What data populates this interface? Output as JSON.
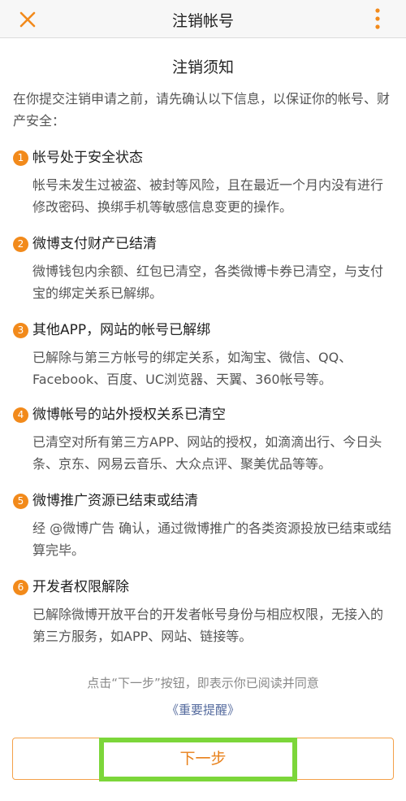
{
  "header": {
    "title": "注销帐号"
  },
  "notice": {
    "title": "注销须知",
    "intro": "在你提交注销申请之前，请先确认以下信息，以保证你的帐号、财产安全："
  },
  "items": [
    {
      "index": "1",
      "title": "帐号处于安全状态",
      "desc": "帐号未发生过被盗、被封等风险，且在最近一个月内没有进行修改密码、换绑手机等敏感信息变更的操作。"
    },
    {
      "index": "2",
      "title": "微博支付财产已结清",
      "desc": "微博钱包内余额、红包已清空，各类微博卡券已清空，与支付宝的绑定关系已解绑。"
    },
    {
      "index": "3",
      "title": "其他APP，网站的帐号已解绑",
      "desc": "已解除与第三方帐号的绑定关系，如淘宝、微信、QQ、Facebook、百度、UC浏览器、天翼、360帐号等。"
    },
    {
      "index": "4",
      "title": "微博帐号的站外授权关系已清空",
      "desc": "已清空对所有第三方APP、网站的授权，如滴滴出行、今日头条、京东、网易云音乐、大众点评、聚美优品等等。"
    },
    {
      "index": "5",
      "title": "微博推广资源已结束或结清",
      "desc": "经 @微博广告 确认，通过微博推广的各类资源投放已结束或结算完毕。"
    },
    {
      "index": "6",
      "title": "开发者权限解除",
      "desc": "已解除微博开放平台的开发者帐号身份与相应权限，无接入的第三方服务，如APP、网站、链接等。"
    }
  ],
  "footer": {
    "note": "点击“下一步”按钮，即表示你已阅读并同意",
    "link": "《重要提醒》",
    "next_label": "下一步"
  },
  "colors": {
    "accent": "#f28a1b",
    "button_text": "#e8801a",
    "link": "#556b9e",
    "highlight": "#7cd63a"
  }
}
